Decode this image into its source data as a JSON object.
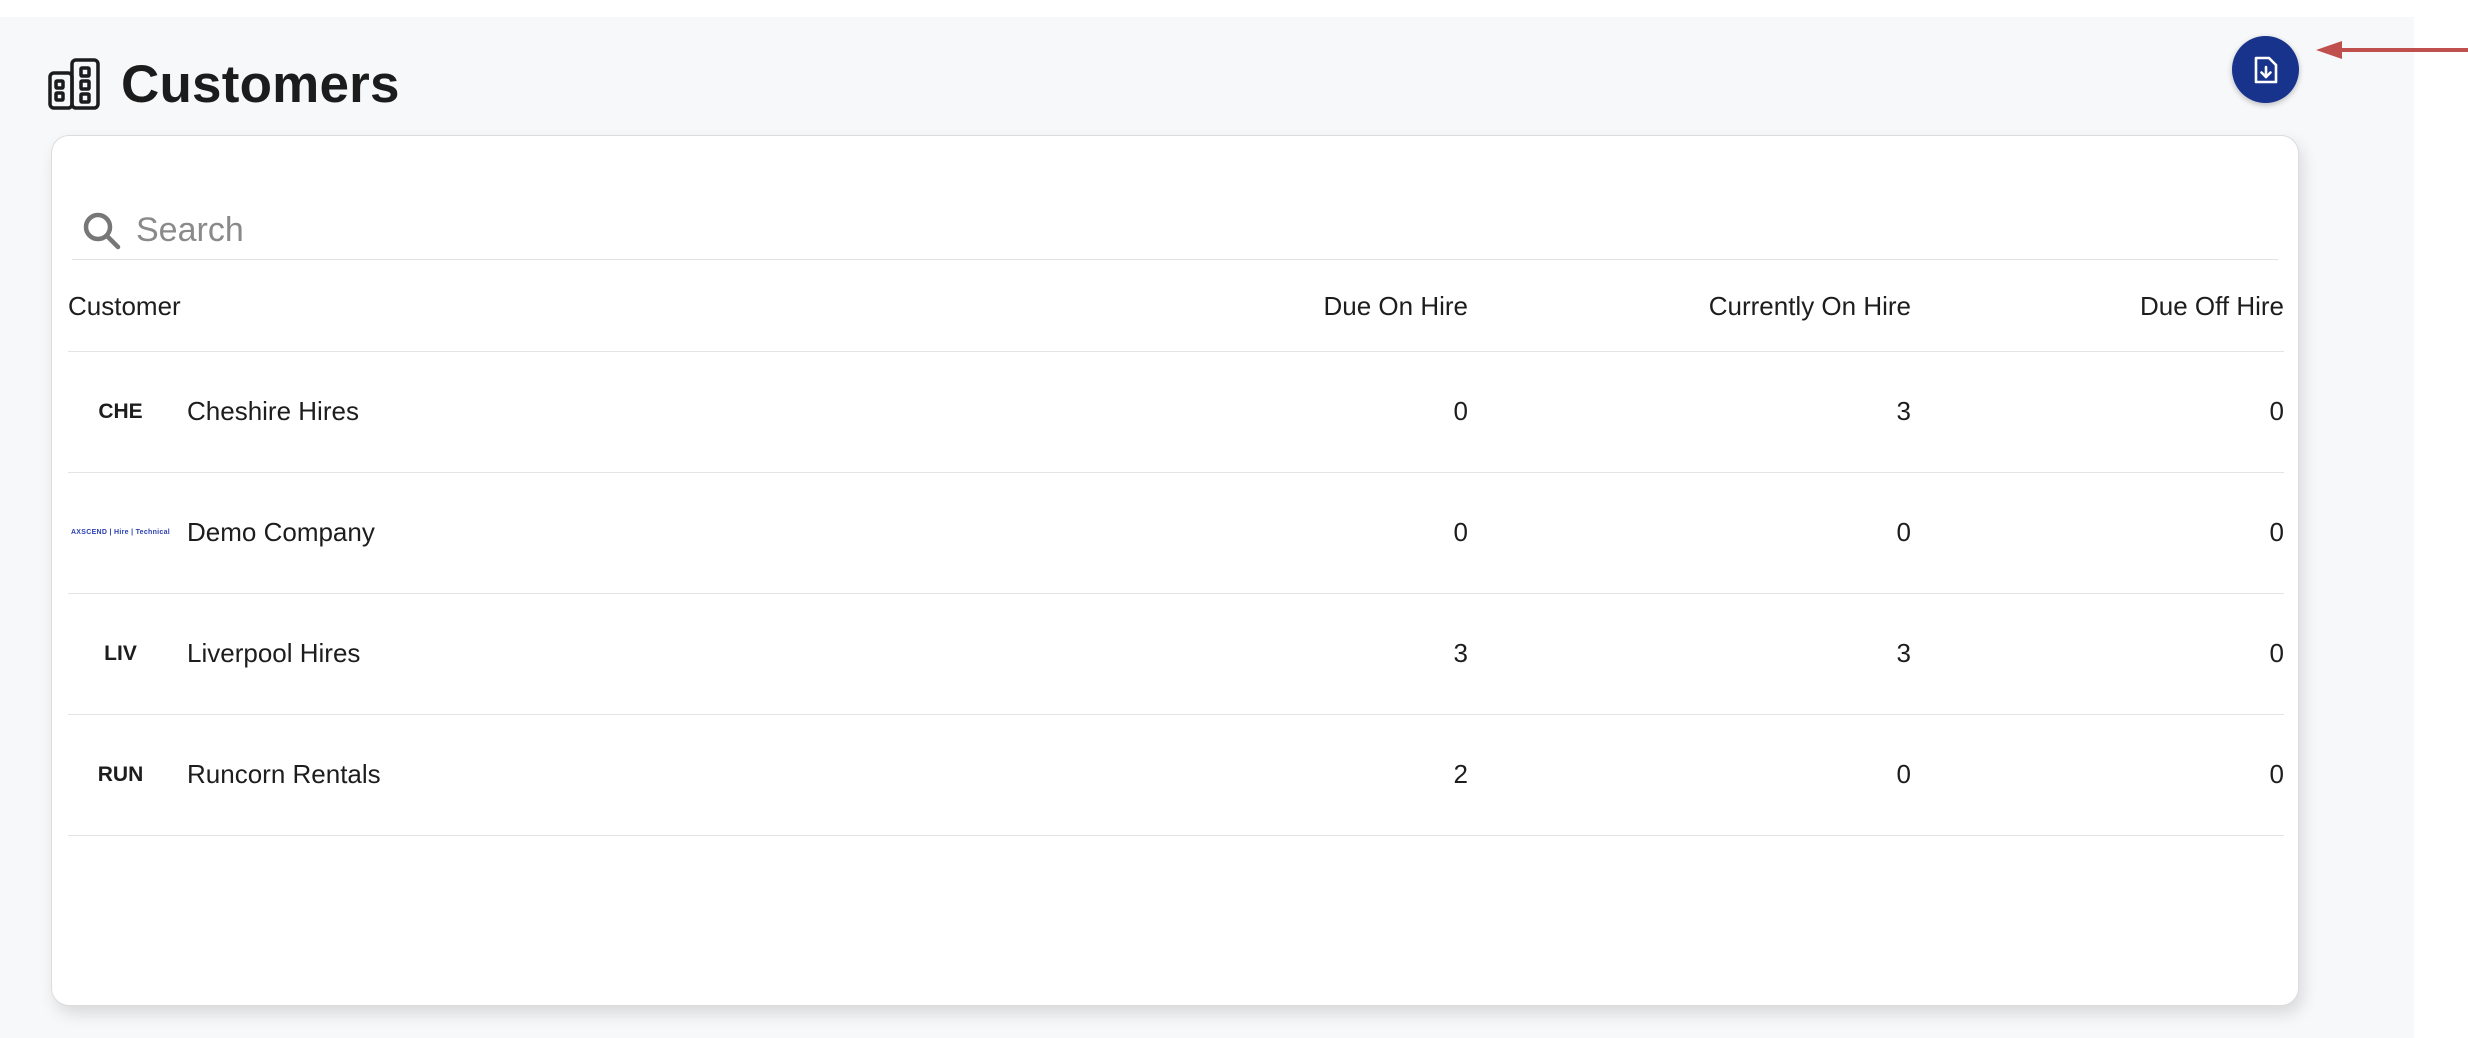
{
  "page": {
    "title": "Customers"
  },
  "colors": {
    "primary": "#18338c",
    "annotation_arrow": "#c0504d"
  },
  "search": {
    "placeholder": "Search"
  },
  "table": {
    "columns": [
      "Customer",
      "Due On Hire",
      "Currently On Hire",
      "Due Off Hire"
    ],
    "rows": [
      {
        "logo": "CHE",
        "name": "Cheshire Hires",
        "due_on_hire": "0",
        "currently_on_hire": "3",
        "due_off_hire": "0"
      },
      {
        "logo": "AXSCEND | Hire | Technical",
        "name": "Demo Company",
        "due_on_hire": "0",
        "currently_on_hire": "0",
        "due_off_hire": "0"
      },
      {
        "logo": "LIV",
        "name": "Liverpool Hires",
        "due_on_hire": "3",
        "currently_on_hire": "3",
        "due_off_hire": "0"
      },
      {
        "logo": "RUN",
        "name": "Runcorn Rentals",
        "due_on_hire": "2",
        "currently_on_hire": "0",
        "due_off_hire": "0"
      }
    ]
  },
  "icons": {
    "title": "buildings-icon",
    "download": "file-download-icon",
    "search": "search-icon",
    "annotation": "arrow-left-icon"
  }
}
